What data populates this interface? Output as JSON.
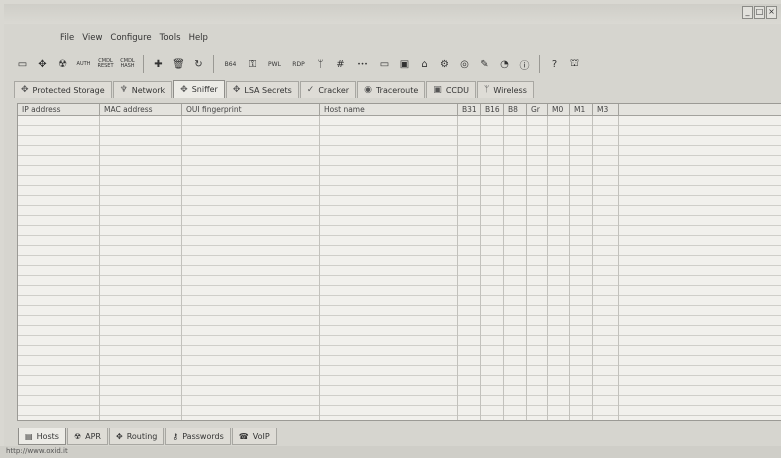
{
  "menu": [
    "File",
    "View",
    "Configure",
    "Tools",
    "Help"
  ],
  "window_controls": [
    "_",
    "□",
    "×"
  ],
  "toolbar": {
    "buttons": [
      {
        "icon": "open-icon",
        "glyph": "▭"
      },
      {
        "icon": "sniffer-icon",
        "glyph": "✥"
      },
      {
        "icon": "apr-icon",
        "glyph": "☢"
      },
      {
        "icon": "auth-icon",
        "glyph": "AUTH"
      },
      {
        "icon": "cmdl-reset-icon",
        "glyph": "CMDL RESET"
      },
      {
        "icon": "cmdl-hash-icon",
        "glyph": "CMDL HASH"
      },
      {
        "icon": "add-icon",
        "glyph": "✚"
      },
      {
        "icon": "delete-icon",
        "glyph": "🗑"
      },
      {
        "icon": "refresh-icon",
        "glyph": "↻"
      },
      {
        "icon": "base64-icon",
        "glyph": "B64"
      },
      {
        "icon": "pass-icon",
        "glyph": "⚿"
      },
      {
        "icon": "pwl-icon",
        "glyph": "PWL"
      },
      {
        "icon": "rdp-icon",
        "glyph": "RDP"
      },
      {
        "icon": "wireless-icon",
        "glyph": "ᛘ"
      },
      {
        "icon": "hash-icon",
        "glyph": "#"
      },
      {
        "icon": "dots-icon",
        "glyph": "•••"
      },
      {
        "icon": "card-icon",
        "glyph": "▭"
      },
      {
        "icon": "monitor-icon",
        "glyph": "▣"
      },
      {
        "icon": "router-icon",
        "glyph": "⌂"
      },
      {
        "icon": "network-icon",
        "glyph": "⚙"
      },
      {
        "icon": "disk-icon",
        "glyph": "◎"
      },
      {
        "icon": "cisco-icon",
        "glyph": "✎"
      },
      {
        "icon": "wifi-icon",
        "glyph": "◔"
      },
      {
        "icon": "info-icon",
        "glyph": "ⓘ"
      },
      {
        "icon": "help-icon",
        "glyph": "?"
      },
      {
        "icon": "exit-icon",
        "glyph": "⛫"
      }
    ]
  },
  "top_tabs": [
    {
      "label": "Protected Storage",
      "icon": "protected-storage-icon",
      "glyph": "✥",
      "active": false
    },
    {
      "label": "Network",
      "icon": "network-icon",
      "glyph": "♆",
      "active": false
    },
    {
      "label": "Sniffer",
      "icon": "sniffer-icon",
      "glyph": "✥",
      "active": true
    },
    {
      "label": "LSA Secrets",
      "icon": "lsa-secrets-icon",
      "glyph": "✥",
      "active": false
    },
    {
      "label": "Cracker",
      "icon": "cracker-icon",
      "glyph": "✓",
      "active": false
    },
    {
      "label": "Traceroute",
      "icon": "traceroute-icon",
      "glyph": "◉",
      "active": false
    },
    {
      "label": "CCDU",
      "icon": "ccdu-icon",
      "glyph": "▣",
      "active": false
    },
    {
      "label": "Wireless",
      "icon": "wireless-icon",
      "glyph": "ᛘ",
      "active": false
    }
  ],
  "table": {
    "columns": [
      "IP address",
      "MAC address",
      "OUI fingerprint",
      "Host name",
      "B31",
      "B16",
      "B8",
      "Gr",
      "M0",
      "M1",
      "M3"
    ]
  },
  "bottom_tabs": [
    {
      "label": "Hosts",
      "icon": "hosts-icon",
      "glyph": "▤",
      "active": true
    },
    {
      "label": "APR",
      "icon": "apr-icon",
      "glyph": "☢",
      "active": false
    },
    {
      "label": "Routing",
      "icon": "routing-icon",
      "glyph": "✥",
      "active": false
    },
    {
      "label": "Passwords",
      "icon": "passwords-icon",
      "glyph": "⚷",
      "active": false
    },
    {
      "label": "VoIP",
      "icon": "voip-icon",
      "glyph": "☎",
      "active": false
    }
  ],
  "status": "http://www.oxid.it"
}
